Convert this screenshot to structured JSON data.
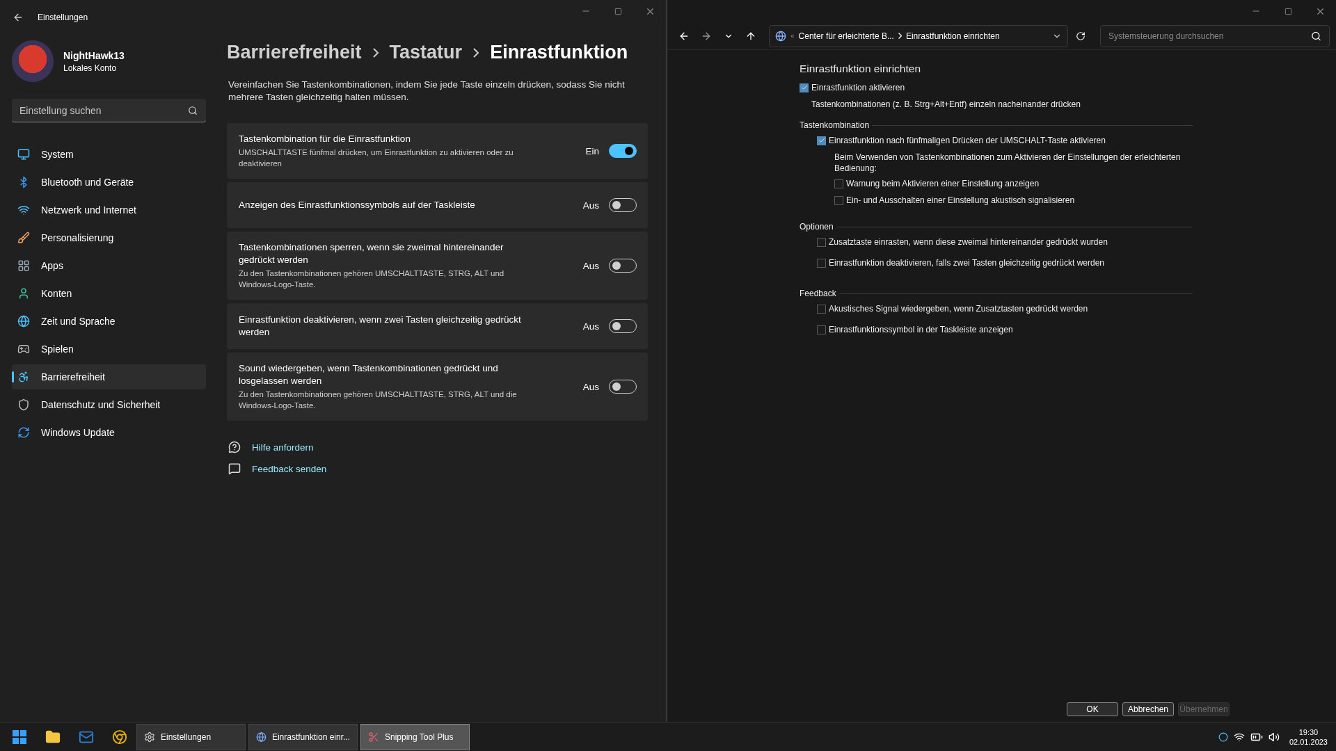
{
  "settings_window": {
    "title": "Einstellungen",
    "profile": {
      "name": "NightHawk13",
      "account": "Lokales Konto"
    },
    "search": {
      "placeholder": "Einstellung suchen"
    },
    "nav": [
      {
        "label": "System",
        "selected": false
      },
      {
        "label": "Bluetooth und Geräte",
        "selected": false
      },
      {
        "label": "Netzwerk und Internet",
        "selected": false
      },
      {
        "label": "Personalisierung",
        "selected": false
      },
      {
        "label": "Apps",
        "selected": false
      },
      {
        "label": "Konten",
        "selected": false
      },
      {
        "label": "Zeit und Sprache",
        "selected": false
      },
      {
        "label": "Spielen",
        "selected": false
      },
      {
        "label": "Barrierefreiheit",
        "selected": true
      },
      {
        "label": "Datenschutz und Sicherheit",
        "selected": false
      },
      {
        "label": "Windows Update",
        "selected": false
      }
    ],
    "breadcrumb": [
      "Barrierefreiheit",
      "Tastatur",
      "Einrastfunktion"
    ],
    "description": "Vereinfachen Sie Tastenkombinationen, indem Sie jede Taste einzeln drücken, sodass Sie nicht mehrere Tasten gleichzeitig halten müssen.",
    "cards": [
      {
        "title": "Tastenkombination für die Einrastfunktion",
        "subtitle": "UMSCHALTTASTE fünfmal drücken, um Einrastfunktion zu aktivieren oder zu deaktivieren",
        "state_label": "Ein",
        "on": true
      },
      {
        "title": "Anzeigen des Einrastfunktionssymbols auf der Taskleiste",
        "state_label": "Aus",
        "on": false
      },
      {
        "title": "Tastenkombinationen sperren, wenn sie zweimal hintereinander gedrückt werden",
        "subtitle": "Zu den Tastenkombinationen gehören UMSCHALTTASTE, STRG, ALT und Windows-Logo-Taste.",
        "state_label": "Aus",
        "on": false
      },
      {
        "title": "Einrastfunktion deaktivieren, wenn zwei Tasten gleichzeitig gedrückt werden",
        "state_label": "Aus",
        "on": false
      },
      {
        "title": "Sound wiedergeben, wenn Tastenkombinationen gedrückt und losgelassen werden",
        "subtitle": "Zu den Tastenkombinationen gehören UMSCHALTTASTE, STRG, ALT und die Windows-Logo-Taste.",
        "state_label": "Aus",
        "on": false
      }
    ],
    "links": [
      "Hilfe anfordern",
      "Feedback senden"
    ]
  },
  "control_panel": {
    "address": {
      "root_marker": "«",
      "parent": "Center für erleichterte B...",
      "current": "Einrastfunktion einrichten"
    },
    "search": {
      "placeholder": "Systemsteuerung durchsuchen"
    },
    "heading": "Einrastfunktion einrichten",
    "main_option": {
      "label": "Einrastfunktion aktivieren",
      "checked": true,
      "hint": "Tastenkombinationen (z. B. Strg+Alt+Entf) einzeln nacheinander drücken"
    },
    "sections": [
      {
        "title": "Tastenkombination",
        "items": [
          {
            "kind": "checkbox",
            "label": "Einrastfunktion nach fünfmaligen Drücken der UMSCHALT-Taste aktivieren",
            "checked": true
          },
          {
            "kind": "note",
            "label": "Beim Verwenden von Tastenkombinationen zum Aktivieren der Einstellungen der erleichterten Bedienung:"
          },
          {
            "kind": "subcheckbox",
            "label": "Warnung beim Aktivieren einer Einstellung anzeigen",
            "checked": false
          },
          {
            "kind": "subcheckbox",
            "label": "Ein- und Ausschalten einer Einstellung akustisch signalisieren",
            "checked": false
          }
        ]
      },
      {
        "title": "Optionen",
        "items": [
          {
            "kind": "checkbox",
            "label": "Zusatztaste einrasten, wenn diese zweimal hintereinander gedrückt wurden",
            "checked": false
          },
          {
            "kind": "checkbox",
            "label": "Einrastfunktion deaktivieren, falls zwei Tasten gleichzeitig gedrückt werden",
            "checked": false
          }
        ]
      },
      {
        "title": "Feedback",
        "items": [
          {
            "kind": "checkbox",
            "label": "Akustisches Signal wiedergeben, wenn Zusatztasten gedrückt werden",
            "checked": false
          },
          {
            "kind": "checkbox",
            "label": "Einrastfunktionssymbol in der Taskleiste anzeigen",
            "checked": false
          }
        ]
      }
    ],
    "buttons": [
      {
        "label": "OK",
        "disabled": false
      },
      {
        "label": "Abbrechen",
        "disabled": false
      },
      {
        "label": "Übernehmen",
        "disabled": true
      }
    ]
  },
  "taskbar": {
    "apps": [
      {
        "label": "Einstellungen",
        "selected": false
      },
      {
        "label": "Einrastfunktion einr...",
        "selected": false
      },
      {
        "label": "Snipping Tool Plus",
        "selected": true
      }
    ],
    "time": "19:30",
    "date": "02.01.2023"
  }
}
